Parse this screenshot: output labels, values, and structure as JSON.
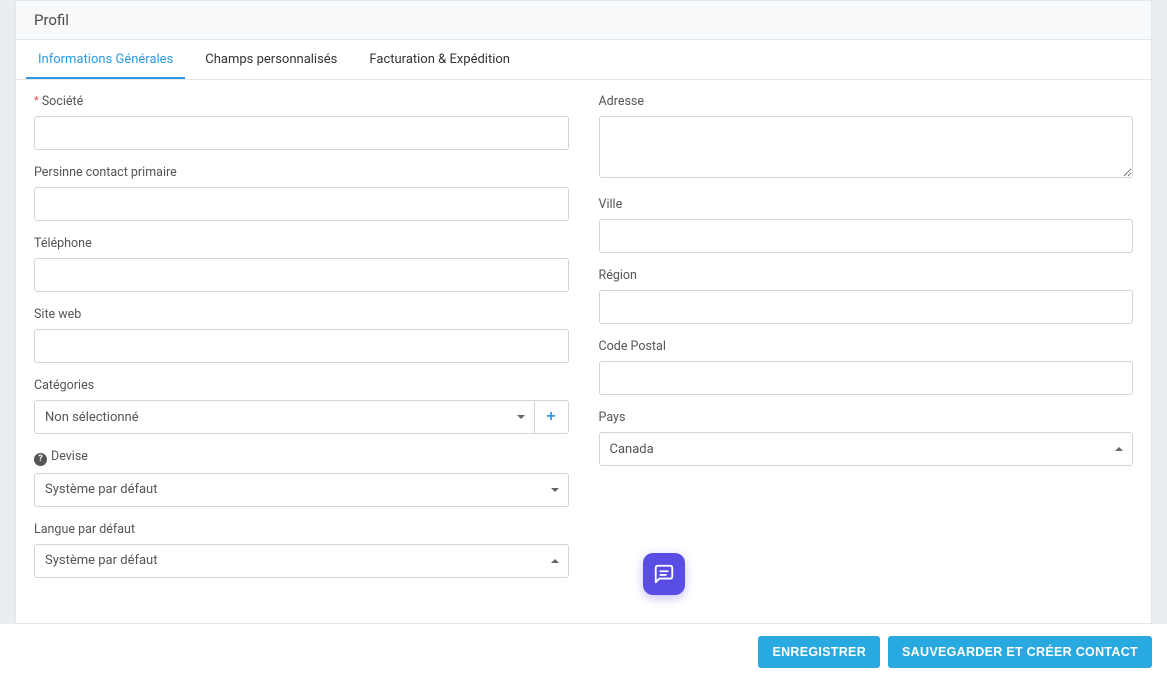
{
  "header": {
    "title": "Profil"
  },
  "tabs": {
    "general": "Informations Générales",
    "custom": "Champs personnalisés",
    "billing": "Facturation & Expédition"
  },
  "labels": {
    "company": "Société",
    "primary_contact": "Persinne contact primaire",
    "phone": "Téléphone",
    "website": "Site web",
    "categories": "Catégories",
    "currency": "Devise",
    "default_language": "Langue par défaut",
    "address": "Adresse",
    "city": "Ville",
    "region": "Région",
    "postal": "Code Postal",
    "country": "Pays"
  },
  "values": {
    "company": "",
    "primary_contact": "",
    "phone": "",
    "website": "",
    "categories": "Non sélectionné",
    "currency": "Système par défaut",
    "default_language": "Système par défaut",
    "address": "",
    "city": "",
    "region": "",
    "postal": "",
    "country": "Canada"
  },
  "icons": {
    "required": "*",
    "help": "?",
    "plus": "+"
  },
  "buttons": {
    "save": "Enregistrer",
    "save_create": "Sauvegarder et créer contact"
  }
}
